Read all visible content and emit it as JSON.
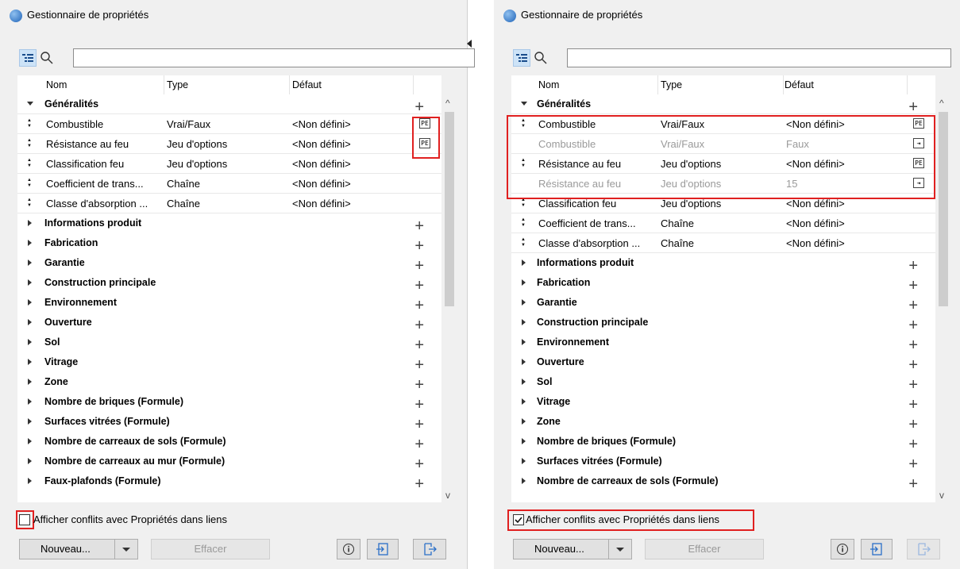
{
  "title": "Gestionnaire de propriétés",
  "columns": {
    "name": "Nom",
    "type": "Type",
    "default": "Défaut"
  },
  "left": {
    "general_group": "Généralités",
    "props": [
      {
        "name": "Combustible",
        "type": "Vrai/Faux",
        "default": "<Non défini>",
        "icon": "PE"
      },
      {
        "name": "Résistance au feu",
        "type": "Jeu d'options",
        "default": "<Non défini>",
        "icon": "PE"
      },
      {
        "name": "Classification feu",
        "type": "Jeu d'options",
        "default": "<Non défini>"
      },
      {
        "name": "Coefficient de trans...",
        "type": "Chaîne",
        "default": "<Non défini>"
      },
      {
        "name": "Classe d'absorption ...",
        "type": "Chaîne",
        "default": "<Non défini>"
      }
    ],
    "groups": [
      "Informations produit",
      "Fabrication",
      "Garantie",
      "Construction principale",
      "Environnement",
      "Ouverture",
      "Sol",
      "Vitrage",
      "Zone",
      "Nombre de briques (Formule)",
      "Surfaces vitrées (Formule)",
      "Nombre de carreaux de sols (Formule)",
      "Nombre de carreaux au mur (Formule)",
      "Faux-plafonds (Formule)"
    ],
    "checkbox_label": "Afficher conflits avec Propriétés dans liens",
    "checkbox_checked": false
  },
  "right": {
    "general_group": "Généralités",
    "props": [
      {
        "name": "Combustible",
        "type": "Vrai/Faux",
        "default": "<Non défini>",
        "icon": "PE",
        "muted": false
      },
      {
        "name": "Combustible",
        "type": "Vrai/Faux",
        "default": "Faux",
        "icon": "→",
        "muted": true
      },
      {
        "name": "Résistance au feu",
        "type": "Jeu d'options",
        "default": "<Non défini>",
        "icon": "PE",
        "muted": false
      },
      {
        "name": "Résistance au feu",
        "type": "Jeu d'options",
        "default": "15",
        "icon": "→",
        "muted": true
      },
      {
        "name": "Classification feu",
        "type": "Jeu d'options",
        "default": "<Non défini>",
        "muted": false
      },
      {
        "name": "Coefficient de trans...",
        "type": "Chaîne",
        "default": "<Non défini>",
        "muted": false
      },
      {
        "name": "Classe d'absorption ...",
        "type": "Chaîne",
        "default": "<Non défini>",
        "muted": false
      }
    ],
    "groups": [
      "Informations produit",
      "Fabrication",
      "Garantie",
      "Construction principale",
      "Environnement",
      "Ouverture",
      "Sol",
      "Vitrage",
      "Zone",
      "Nombre de briques (Formule)",
      "Surfaces vitrées (Formule)",
      "Nombre de carreaux de sols (Formule)"
    ],
    "checkbox_label": "Afficher conflits avec Propriétés dans liens",
    "checkbox_checked": true
  },
  "buttons": {
    "new": "Nouveau...",
    "delete": "Effacer"
  },
  "colors": {
    "highlight": "#e02020",
    "selected_tool": "#cde3f7"
  }
}
